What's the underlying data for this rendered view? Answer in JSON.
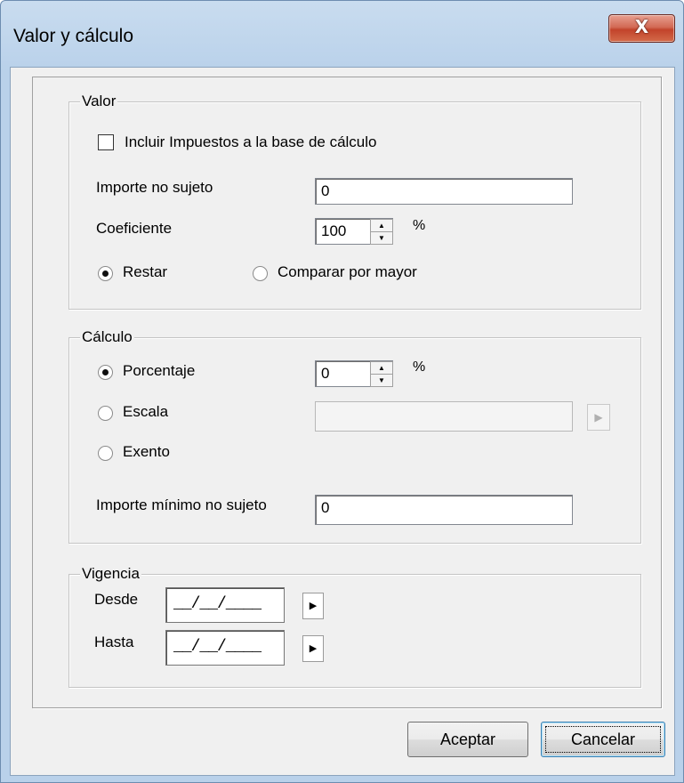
{
  "window": {
    "title": "Valor y cálculo",
    "close_glyph": "X"
  },
  "valor": {
    "legend": "Valor",
    "incluir_label": "Incluir Impuestos a la base de cálculo",
    "incluir_checked": false,
    "importe_no_sujeto_label": "Importe no sujeto",
    "importe_no_sujeto_value": "0",
    "coeficiente_label": "Coeficiente",
    "coeficiente_value": "100",
    "coeficiente_unit": "%",
    "restar_label": "Restar",
    "comparar_label": "Comparar por mayor",
    "selected_option": "Restar"
  },
  "calculo": {
    "legend": "Cálculo",
    "porcentaje_label": "Porcentaje",
    "porcentaje_value": "0",
    "porcentaje_unit": "%",
    "escala_label": "Escala",
    "escala_value": "",
    "exento_label": "Exento",
    "importe_minimo_label": "Importe mínimo no sujeto",
    "importe_minimo_value": "0",
    "selected_option": "Porcentaje"
  },
  "vigencia": {
    "legend": "Vigencia",
    "desde_label": "Desde",
    "desde_value": "__/__/____",
    "hasta_label": "Hasta",
    "hasta_value": "__/__/____"
  },
  "buttons": {
    "aceptar": "Aceptar",
    "cancelar": "Cancelar"
  },
  "icons": {
    "spin_up": "triangle-up",
    "spin_down": "triangle-down",
    "arrow_right": "triangle-right"
  },
  "colors": {
    "dialog_bg": "#f0f0f0",
    "title_bg": "#c9dcef",
    "close_button": "#c2432b"
  }
}
